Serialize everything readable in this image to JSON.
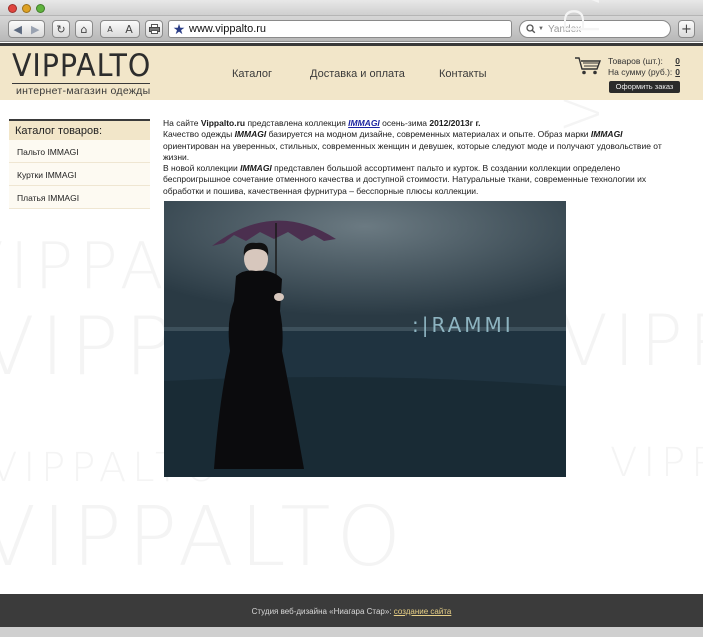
{
  "browser": {
    "url": "www.vippalto.ru",
    "search_placeholder": "Yandex",
    "font_small": "A",
    "font_large": "A",
    "new_tab": "+"
  },
  "header": {
    "logo": "VIPPALTO",
    "tagline": "интернет-магазин одежды",
    "nav": [
      "Каталог",
      "Доставка и оплата",
      "Контакты"
    ],
    "cart": {
      "items_label": "Товаров (шт.):",
      "items_value": "0",
      "sum_label": "На сумму (руб.):",
      "sum_value": "0",
      "order_button": "Оформить заказ"
    }
  },
  "watermark": "VIPPALTO",
  "sidebar": {
    "title": "Каталог товаров:",
    "items": [
      "Пальто IMMAGI",
      "Куртки IMMAGI",
      "Платья IMMAGI"
    ]
  },
  "content": {
    "p1_prefix": "На сайте ",
    "p1_site": "Vippalto.ru",
    "p1_mid": " представлена коллекция ",
    "p1_brand": "IMMAGI",
    "p1_mid2": " осень-зима ",
    "p1_season": "2012/2013г г.",
    "p2_prefix": "Качество одежды ",
    "p2_brand": "IMMAGI",
    "p2_mid": " базируется на модном дизайне, современных материалах  и опыте.  Образ марки ",
    "p2_brand2": "IMMAGI",
    "p2_rest": " ориентирован на уверенных, стильных,  современных женщин и девушек,  которые следуют моде и получают удовольствие от жизни.",
    "p3_prefix": "В новой коллекции ",
    "p3_brand": "IMMAGI",
    "p3_rest": " представлен большой ассортимент пальто и курток.  В создании коллекции определено беспроигрышное сочетание отменного качества и доступной стоимости. Натуральные ткани, современные технологии их обработки и пошива,  качественная фурнитура – бесспорные плюсы коллекции.",
    "hero_text": ":|RAMMI"
  },
  "footer": {
    "text": "Студия веб-дизайна «Ниагара Стар»: ",
    "link": "создание сайта"
  }
}
